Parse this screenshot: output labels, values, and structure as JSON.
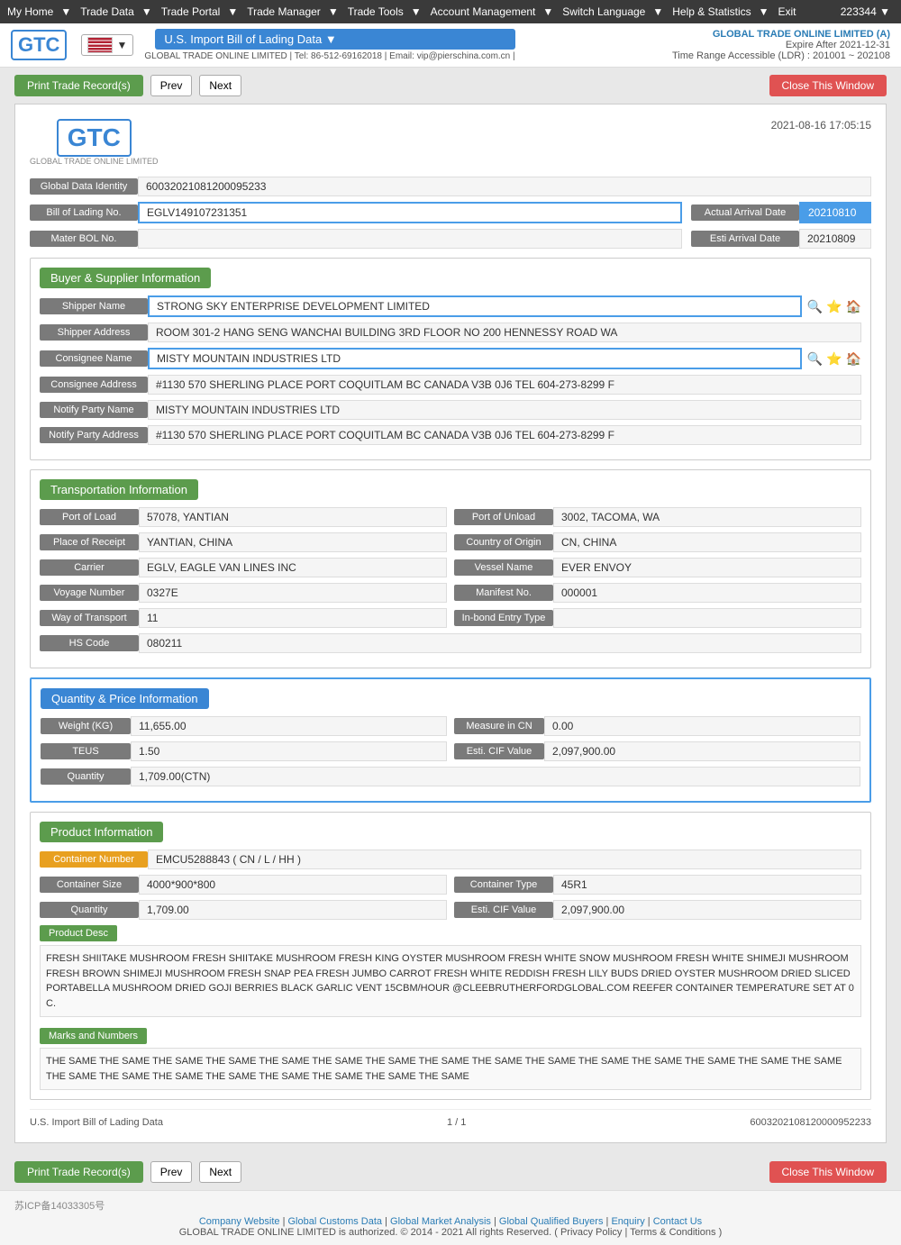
{
  "topnav": {
    "items": [
      "My Home",
      "Trade Data",
      "Trade Portal",
      "Trade Manager",
      "Trade Tools",
      "Account Management",
      "Switch Language",
      "Help & Statistics",
      "Exit"
    ],
    "account_num": "223344 ▼"
  },
  "header": {
    "company": "GLOBAL TRADE ONLINE LIMITED (A)",
    "expire": "Expire After 2021-12-31",
    "time_range": "Time Range Accessible (LDR) : 201001 ~ 202108",
    "selector": "U.S. Import Bill of Lading Data ▼",
    "contact": "GLOBAL TRADE ONLINE LIMITED | Tel: 86-512-69162018 | Email: vip@pierschina.com.cn |"
  },
  "toolbar": {
    "print_label": "Print Trade Record(s)",
    "prev_label": "Prev",
    "next_label": "Next",
    "close_label": "Close This Window"
  },
  "record": {
    "datetime": "2021-08-16 17:05:15",
    "global_data_identity_label": "Global Data Identity",
    "global_data_identity_value": "60032021081200095233",
    "bill_of_lading_label": "Bill of Lading No.",
    "bill_of_lading_value": "EGLV149107231351",
    "actual_arrival_label": "Actual Arrival Date",
    "actual_arrival_value": "20210810",
    "mater_bol_label": "Mater BOL No.",
    "mater_bol_value": "",
    "esti_arrival_label": "Esti Arrival Date",
    "esti_arrival_value": "20210809"
  },
  "buyer_supplier": {
    "section_title": "Buyer & Supplier Information",
    "shipper_name_label": "Shipper Name",
    "shipper_name_value": "STRONG SKY ENTERPRISE DEVELOPMENT LIMITED",
    "shipper_address_label": "Shipper Address",
    "shipper_address_value": "ROOM 301-2 HANG SENG WANCHAI BUILDING 3RD FLOOR NO 200 HENNESSY ROAD WA",
    "consignee_name_label": "Consignee Name",
    "consignee_name_value": "MISTY MOUNTAIN INDUSTRIES LTD",
    "consignee_address_label": "Consignee Address",
    "consignee_address_value": "#1130 570 SHERLING PLACE PORT COQUITLAM BC CANADA V3B 0J6 TEL 604-273-8299 F",
    "notify_party_name_label": "Notify Party Name",
    "notify_party_name_value": "MISTY MOUNTAIN INDUSTRIES LTD",
    "notify_party_address_label": "Notify Party Address",
    "notify_party_address_value": "#1130 570 SHERLING PLACE PORT COQUITLAM BC CANADA V3B 0J6 TEL 604-273-8299 F"
  },
  "transportation": {
    "section_title": "Transportation Information",
    "port_of_load_label": "Port of Load",
    "port_of_load_value": "57078, YANTIAN",
    "port_of_unload_label": "Port of Unload",
    "port_of_unload_value": "3002, TACOMA, WA",
    "place_of_receipt_label": "Place of Receipt",
    "place_of_receipt_value": "YANTIAN, CHINA",
    "country_of_origin_label": "Country of Origin",
    "country_of_origin_value": "CN, CHINA",
    "carrier_label": "Carrier",
    "carrier_value": "EGLV, EAGLE VAN LINES INC",
    "vessel_name_label": "Vessel Name",
    "vessel_name_value": "EVER ENVOY",
    "voyage_number_label": "Voyage Number",
    "voyage_number_value": "0327E",
    "manifest_no_label": "Manifest No.",
    "manifest_no_value": "000001",
    "way_of_transport_label": "Way of Transport",
    "way_of_transport_value": "11",
    "in_bond_label": "In-bond Entry Type",
    "in_bond_value": "",
    "hs_code_label": "HS Code",
    "hs_code_value": "080211"
  },
  "quantity_price": {
    "section_title": "Quantity & Price Information",
    "weight_label": "Weight (KG)",
    "weight_value": "11,655.00",
    "measure_label": "Measure in CN",
    "measure_value": "0.00",
    "teus_label": "TEUS",
    "teus_value": "1.50",
    "esti_cif_label": "Esti. CIF Value",
    "esti_cif_value": "2,097,900.00",
    "quantity_label": "Quantity",
    "quantity_value": "1,709.00(CTN)"
  },
  "product": {
    "section_title": "Product Information",
    "container_number_label": "Container Number",
    "container_number_value": "EMCU5288843 ( CN / L / HH )",
    "container_size_label": "Container Size",
    "container_size_value": "4000*900*800",
    "container_type_label": "Container Type",
    "container_type_value": "45R1",
    "quantity_label": "Quantity",
    "quantity_value": "1,709.00",
    "esti_cif_label": "Esti. CIF Value",
    "esti_cif_value": "2,097,900.00",
    "product_desc_label": "Product Desc",
    "product_desc_value": "FRESH SHIITAKE MUSHROOM FRESH SHIITAKE MUSHROOM FRESH KING OYSTER MUSHROOM FRESH WHITE SNOW MUSHROOM FRESH WHITE SHIMEJI MUSHROOM FRESH BROWN SHIMEJI MUSHROOM FRESH SNAP PEA FRESH JUMBO CARROT FRESH WHITE REDDISH FRESH LILY BUDS DRIED OYSTER MUSHROOM DRIED SLICED PORTABELLA MUSHROOM DRIED GOJI BERRIES BLACK GARLIC VENT 15CBM/HOUR @CLEEBRUTHERFORDGLOBAL.COM REEFER CONTAINER TEMPERATURE SET AT 0 C.",
    "marks_label": "Marks and Numbers",
    "marks_value": "THE SAME THE SAME THE SAME THE SAME THE SAME THE SAME THE SAME THE SAME THE SAME THE SAME THE SAME THE SAME THE SAME THE SAME THE SAME THE SAME THE SAME THE SAME THE SAME THE SAME THE SAME THE SAME THE SAME"
  },
  "card_footer": {
    "left": "U.S. Import Bill of Lading Data",
    "middle": "1 / 1",
    "right": "6003202108120000952233"
  },
  "site_footer": {
    "icp": "苏ICP备14033305号",
    "links": [
      "Company Website",
      "Global Customs Data",
      "Global Market Analysis",
      "Global Qualified Buyers",
      "Enquiry",
      "Contact Us"
    ],
    "copyright": "GLOBAL TRADE ONLINE LIMITED is authorized. © 2014 - 2021 All rights Reserved.  ( Privacy Policy | Terms & Conditions )"
  }
}
